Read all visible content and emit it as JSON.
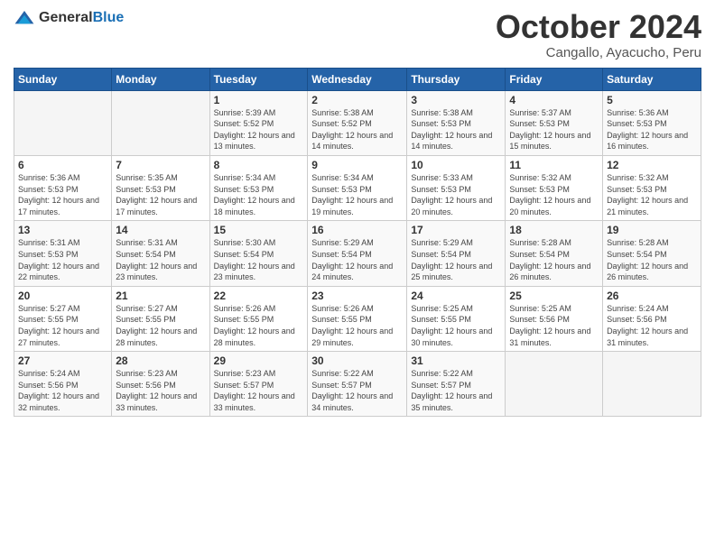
{
  "logo": {
    "general": "General",
    "blue": "Blue"
  },
  "header": {
    "month": "October 2024",
    "location": "Cangallo, Ayacucho, Peru"
  },
  "days_of_week": [
    "Sunday",
    "Monday",
    "Tuesday",
    "Wednesday",
    "Thursday",
    "Friday",
    "Saturday"
  ],
  "weeks": [
    [
      {
        "day": "",
        "info": ""
      },
      {
        "day": "",
        "info": ""
      },
      {
        "day": "1",
        "info": "Sunrise: 5:39 AM\nSunset: 5:52 PM\nDaylight: 12 hours and 13 minutes."
      },
      {
        "day": "2",
        "info": "Sunrise: 5:38 AM\nSunset: 5:52 PM\nDaylight: 12 hours and 14 minutes."
      },
      {
        "day": "3",
        "info": "Sunrise: 5:38 AM\nSunset: 5:53 PM\nDaylight: 12 hours and 14 minutes."
      },
      {
        "day": "4",
        "info": "Sunrise: 5:37 AM\nSunset: 5:53 PM\nDaylight: 12 hours and 15 minutes."
      },
      {
        "day": "5",
        "info": "Sunrise: 5:36 AM\nSunset: 5:53 PM\nDaylight: 12 hours and 16 minutes."
      }
    ],
    [
      {
        "day": "6",
        "info": "Sunrise: 5:36 AM\nSunset: 5:53 PM\nDaylight: 12 hours and 17 minutes."
      },
      {
        "day": "7",
        "info": "Sunrise: 5:35 AM\nSunset: 5:53 PM\nDaylight: 12 hours and 17 minutes."
      },
      {
        "day": "8",
        "info": "Sunrise: 5:34 AM\nSunset: 5:53 PM\nDaylight: 12 hours and 18 minutes."
      },
      {
        "day": "9",
        "info": "Sunrise: 5:34 AM\nSunset: 5:53 PM\nDaylight: 12 hours and 19 minutes."
      },
      {
        "day": "10",
        "info": "Sunrise: 5:33 AM\nSunset: 5:53 PM\nDaylight: 12 hours and 20 minutes."
      },
      {
        "day": "11",
        "info": "Sunrise: 5:32 AM\nSunset: 5:53 PM\nDaylight: 12 hours and 20 minutes."
      },
      {
        "day": "12",
        "info": "Sunrise: 5:32 AM\nSunset: 5:53 PM\nDaylight: 12 hours and 21 minutes."
      }
    ],
    [
      {
        "day": "13",
        "info": "Sunrise: 5:31 AM\nSunset: 5:53 PM\nDaylight: 12 hours and 22 minutes."
      },
      {
        "day": "14",
        "info": "Sunrise: 5:31 AM\nSunset: 5:54 PM\nDaylight: 12 hours and 23 minutes."
      },
      {
        "day": "15",
        "info": "Sunrise: 5:30 AM\nSunset: 5:54 PM\nDaylight: 12 hours and 23 minutes."
      },
      {
        "day": "16",
        "info": "Sunrise: 5:29 AM\nSunset: 5:54 PM\nDaylight: 12 hours and 24 minutes."
      },
      {
        "day": "17",
        "info": "Sunrise: 5:29 AM\nSunset: 5:54 PM\nDaylight: 12 hours and 25 minutes."
      },
      {
        "day": "18",
        "info": "Sunrise: 5:28 AM\nSunset: 5:54 PM\nDaylight: 12 hours and 26 minutes."
      },
      {
        "day": "19",
        "info": "Sunrise: 5:28 AM\nSunset: 5:54 PM\nDaylight: 12 hours and 26 minutes."
      }
    ],
    [
      {
        "day": "20",
        "info": "Sunrise: 5:27 AM\nSunset: 5:55 PM\nDaylight: 12 hours and 27 minutes."
      },
      {
        "day": "21",
        "info": "Sunrise: 5:27 AM\nSunset: 5:55 PM\nDaylight: 12 hours and 28 minutes."
      },
      {
        "day": "22",
        "info": "Sunrise: 5:26 AM\nSunset: 5:55 PM\nDaylight: 12 hours and 28 minutes."
      },
      {
        "day": "23",
        "info": "Sunrise: 5:26 AM\nSunset: 5:55 PM\nDaylight: 12 hours and 29 minutes."
      },
      {
        "day": "24",
        "info": "Sunrise: 5:25 AM\nSunset: 5:55 PM\nDaylight: 12 hours and 30 minutes."
      },
      {
        "day": "25",
        "info": "Sunrise: 5:25 AM\nSunset: 5:56 PM\nDaylight: 12 hours and 31 minutes."
      },
      {
        "day": "26",
        "info": "Sunrise: 5:24 AM\nSunset: 5:56 PM\nDaylight: 12 hours and 31 minutes."
      }
    ],
    [
      {
        "day": "27",
        "info": "Sunrise: 5:24 AM\nSunset: 5:56 PM\nDaylight: 12 hours and 32 minutes."
      },
      {
        "day": "28",
        "info": "Sunrise: 5:23 AM\nSunset: 5:56 PM\nDaylight: 12 hours and 33 minutes."
      },
      {
        "day": "29",
        "info": "Sunrise: 5:23 AM\nSunset: 5:57 PM\nDaylight: 12 hours and 33 minutes."
      },
      {
        "day": "30",
        "info": "Sunrise: 5:22 AM\nSunset: 5:57 PM\nDaylight: 12 hours and 34 minutes."
      },
      {
        "day": "31",
        "info": "Sunrise: 5:22 AM\nSunset: 5:57 PM\nDaylight: 12 hours and 35 minutes."
      },
      {
        "day": "",
        "info": ""
      },
      {
        "day": "",
        "info": ""
      }
    ]
  ]
}
